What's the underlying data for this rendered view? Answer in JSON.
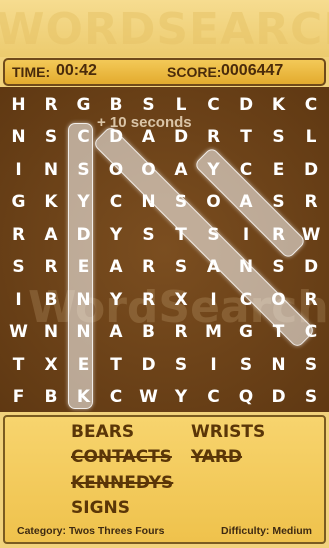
{
  "header": {
    "banner_text": "WORDSEARCH"
  },
  "status": {
    "time_label": "TIME:",
    "time_value": "00:42",
    "score_label": "SCORE:",
    "score_value": "0006447"
  },
  "board": {
    "watermark": "WordSearch",
    "bonus_text": "+ 10 seconds",
    "rows": [
      [
        "H",
        "R",
        "G",
        "B",
        "S",
        "L",
        "C",
        "D",
        "K",
        "C"
      ],
      [
        "N",
        "S",
        "C",
        "D",
        "A",
        "D",
        "R",
        "T",
        "S",
        "L"
      ],
      [
        "I",
        "N",
        "S",
        "O",
        "O",
        "A",
        "Y",
        "C",
        "E",
        "D"
      ],
      [
        "G",
        "K",
        "Y",
        "C",
        "N",
        "S",
        "O",
        "A",
        "S",
        "R"
      ],
      [
        "R",
        "A",
        "D",
        "Y",
        "S",
        "T",
        "S",
        "I",
        "R",
        "W"
      ],
      [
        "S",
        "R",
        "E",
        "A",
        "R",
        "S",
        "A",
        "N",
        "S",
        "D"
      ],
      [
        "I",
        "B",
        "N",
        "Y",
        "R",
        "X",
        "I",
        "C",
        "O",
        "R"
      ],
      [
        "W",
        "N",
        "N",
        "A",
        "B",
        "R",
        "M",
        "G",
        "T",
        "C"
      ],
      [
        "T",
        "X",
        "E",
        "T",
        "D",
        "S",
        "I",
        "S",
        "N",
        "S"
      ],
      [
        "F",
        "B",
        "K",
        "C",
        "W",
        "Y",
        "C",
        "Q",
        "D",
        "S"
      ]
    ]
  },
  "words": {
    "items": [
      {
        "text": "BEARS",
        "found": false
      },
      {
        "text": "CONTACTS",
        "found": true
      },
      {
        "text": "KENNEDYS",
        "found": true
      },
      {
        "text": "SIGNS",
        "found": false
      },
      {
        "text": "WRISTS",
        "found": false
      },
      {
        "text": "YARD",
        "found": true
      }
    ],
    "category": "Category: Twos Threes Fours",
    "difficulty": "Difficulty: Medium"
  },
  "colors": {
    "board": "#6d4318",
    "panel": "#f0c24c",
    "text_dark": "#4a2b0b",
    "highlight": "#ffffff"
  }
}
